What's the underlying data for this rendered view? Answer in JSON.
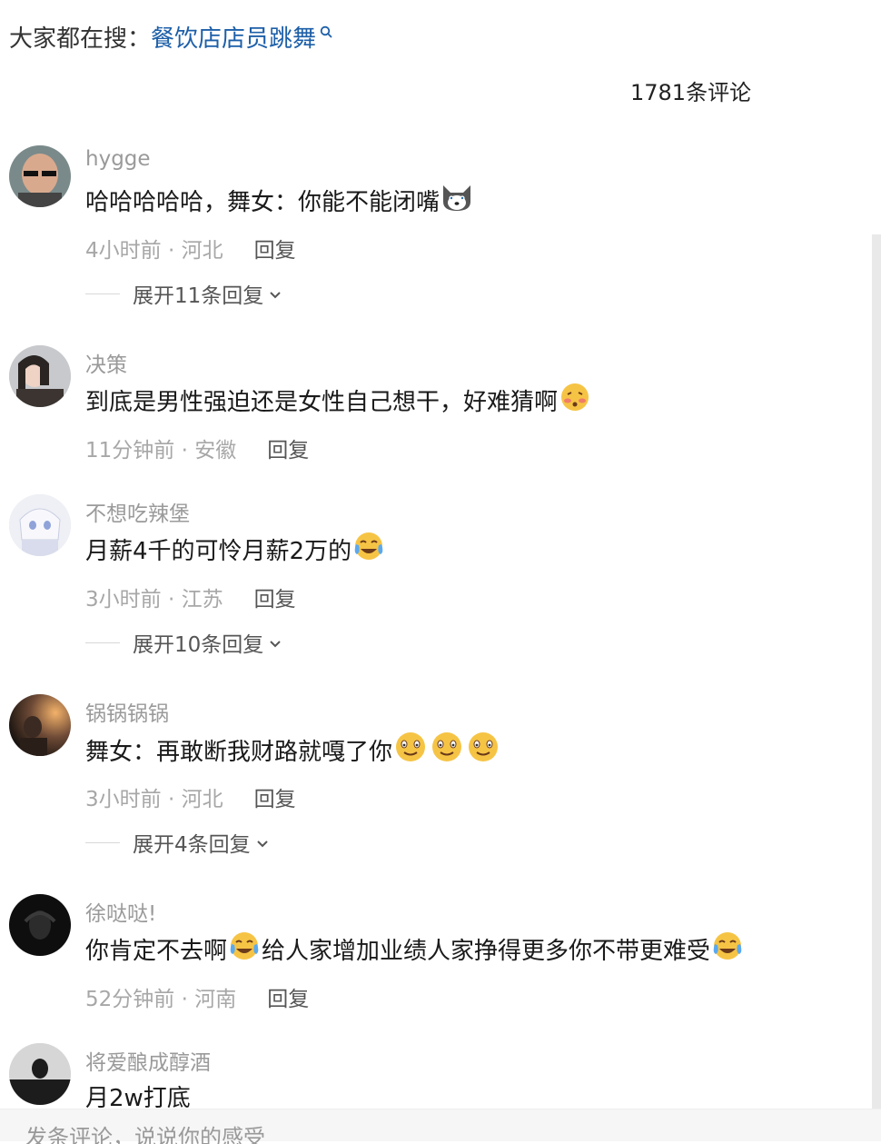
{
  "search": {
    "prefix": "大家都在搜：",
    "query": "餐饮店店员跳舞"
  },
  "comment_count": "1781条评论",
  "comments": [
    {
      "user": "hygge",
      "text": "哈哈哈哈哈，舞女：你能不能闭嘴",
      "emoji": [
        "husky-emoji"
      ],
      "meta": "4小时前 · 河北",
      "reply": "回复",
      "expand": "展开11条回复"
    },
    {
      "user": "决策",
      "text": "到底是男性强迫还是女性自己想干，好难猜啊",
      "emoji": [
        "blushing-emoji"
      ],
      "meta": "11分钟前 · 安徽",
      "reply": "回复"
    },
    {
      "user": "不想吃辣堡",
      "text": "月薪4千的可怜月薪2万的",
      "emoji": [
        "crying-emoji"
      ],
      "meta": "3小时前 · 江苏",
      "reply": "回复",
      "expand": "展开10条回复"
    },
    {
      "user": "锅锅锅锅",
      "text": "舞女：再敢断我财路就嘎了你",
      "emoji": [
        "smiling-emoji",
        "smiling-emoji",
        "smiling-emoji"
      ],
      "meta": "3小时前 · 河北",
      "reply": "回复",
      "expand": "展开4条回复"
    },
    {
      "user": "徐哒哒!",
      "text_before": "你肯定不去啊",
      "text_after": "给人家增加业绩人家挣得更多你不带更难受",
      "emoji": [
        "crying-emoji",
        "crying-emoji"
      ],
      "meta": "52分钟前 · 河南",
      "reply": "回复"
    },
    {
      "user": "将爱酿成醇酒",
      "text": "月2w打底"
    }
  ],
  "bottom": {
    "placeholder": "发条评论，说说你的感受"
  },
  "colors": {
    "link": "#1d5fa8",
    "meta": "#a7a7a7",
    "username": "#9a9a9a"
  }
}
